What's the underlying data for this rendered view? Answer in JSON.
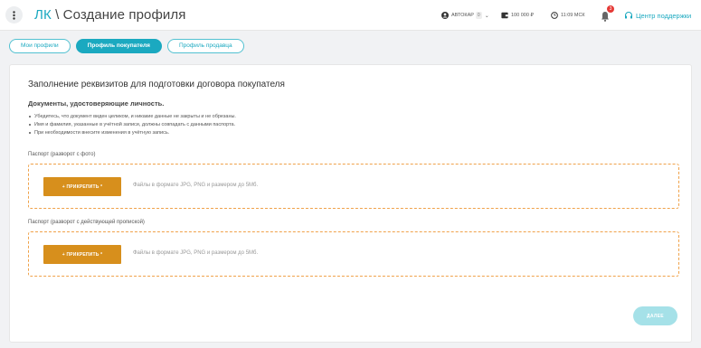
{
  "header": {
    "crumb_link": "ЛК",
    "crumb_separator": "\\",
    "page_title": "Создание профиля",
    "account_label": "АВТОКАР",
    "account_badge": "0",
    "balance": "100 000 ₽",
    "time": "11:09 МСК",
    "notifications_count": "3",
    "support_label": "Центр поддержки"
  },
  "tabs": [
    {
      "label": "Мои профили"
    },
    {
      "label": "Профиль покупателя"
    },
    {
      "label": "Профиль продавца"
    }
  ],
  "form": {
    "title": "Заполнение реквизитов для подготовки договора покупателя",
    "docs_heading": "Документы, удостоверяющие личность.",
    "bullets": [
      "Убедитесь, что документ виден целиком, и никакие данные не закрыты и не обрезаны.",
      "Имя и фамилия, указанные в учётной записи, должны совпадать с данными паспорта.",
      "При необходимости внесите изменения в учётную запись."
    ],
    "fields": [
      {
        "label": "Паспорт (разворот с фото)",
        "button_label": "+ ПРИКРЕПИТЬ *",
        "hint": "Файлы в формате JPG, PNG и размером до 5Мб."
      },
      {
        "label": "Паспорт (разворот с действующей пропиской)",
        "button_label": "+ ПРИКРЕПИТЬ *",
        "hint": "Файлы в формате JPG, PNG и размером до 5Мб."
      }
    ],
    "next_label": "ДАЛЕЕ"
  },
  "colors": {
    "accent": "#1ba9c0",
    "attach_button": "#d78f1c",
    "dropzone_border": "#f0a24a",
    "next_disabled": "#a5e1e8",
    "notification": "#e53935"
  },
  "icons": {
    "menu": "vertical-dots-icon",
    "account": "user-circle-icon",
    "balance": "wallet-icon",
    "clock": "clock-icon",
    "notifications": "bell-icon",
    "support": "headset-icon"
  }
}
